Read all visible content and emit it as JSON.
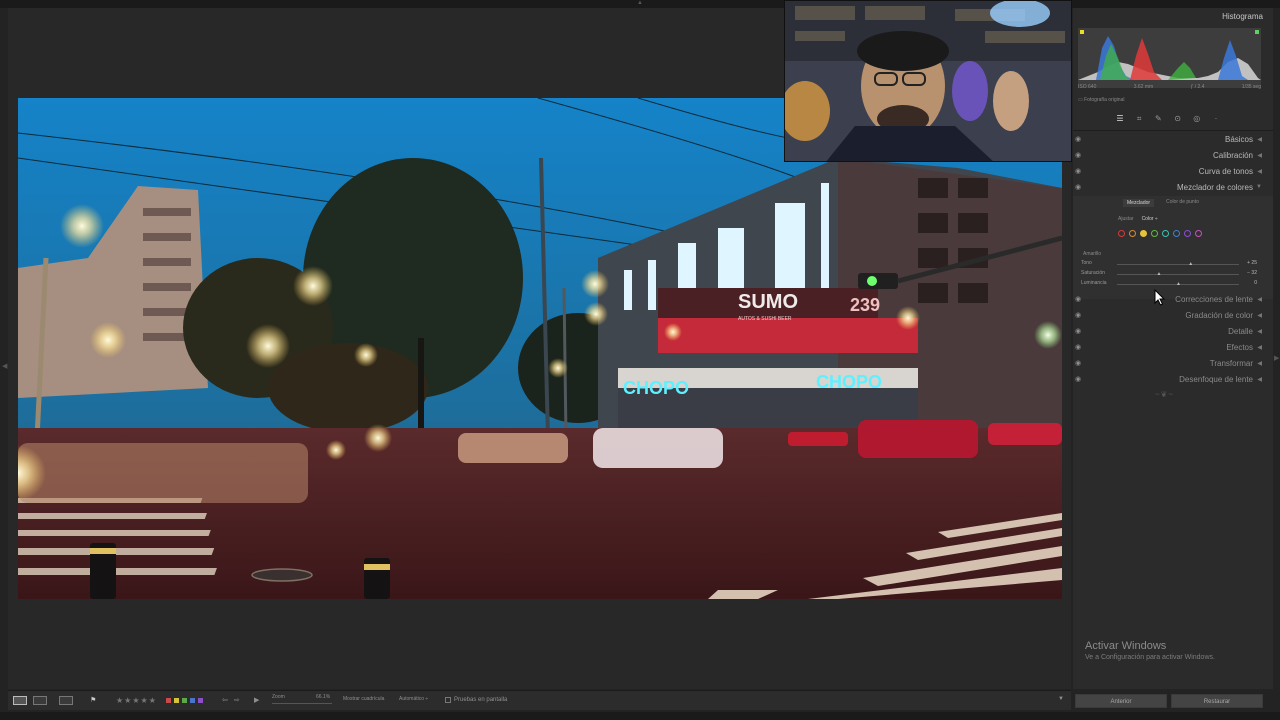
{
  "histogram": {
    "title": "Histograma",
    "meta": [
      "ISO 640",
      "3.62 mm",
      "ƒ / 2.4",
      "1/35 seg"
    ],
    "original_photo_label": "Fotografía original"
  },
  "tools": [
    "sliders-icon",
    "crop-icon",
    "heal-icon",
    "redeye-icon",
    "mask-icon",
    "brush-icon",
    "more-icon"
  ],
  "panels": {
    "basicos": "Básicos",
    "calibracion": "Calibración",
    "curva": "Curva de tonos",
    "mezclador": "Mezclador de colores",
    "correcciones": "Correcciones de lente",
    "gradacion": "Gradación de color",
    "detalle": "Detalle",
    "efectos": "Efectos",
    "transformar": "Transformar",
    "desenfoque": "Desenfoque de lente"
  },
  "mixer": {
    "tab_mixer": "Mezclador",
    "tab_point": "Color de punto",
    "adjust_label": "Ajustar",
    "adjust_value": "Color ÷",
    "selected_color": "Amarillo",
    "colors": [
      "#d23c3c",
      "#e08a2a",
      "#e6c43a",
      "#5fbf3b",
      "#3ec1b4",
      "#3b82d6",
      "#8a4fd0",
      "#d14bc3"
    ],
    "sliders": [
      {
        "name": "Tono",
        "value": "+ 25",
        "pos": 0.6
      },
      {
        "name": "Saturación",
        "value": "− 32",
        "pos": 0.34
      },
      {
        "name": "Luminancia",
        "value": "0",
        "pos": 0.5
      }
    ]
  },
  "windows": {
    "title": "Activar Windows",
    "subtitle": "Ve a Configuración para activar Windows."
  },
  "buttons": {
    "previous": "Anterior",
    "reset": "Restaurar"
  },
  "bottombar": {
    "zoom_label": "Zoom",
    "zoom_value": "66.1%",
    "grid_label": "Mostrar cuadrícula",
    "grid_value": "Automático ÷",
    "softproof_label": "Pruebas en pantalla",
    "stars": "★★★★★",
    "flags": [
      "#c94a4a",
      "#d4c43a",
      "#5fa84a",
      "#4a74c9",
      "#8a4fc9"
    ]
  },
  "photo": {
    "sign_sumo": "SUMO",
    "sign_sumo_sub": "AUTOS & SUSHI BEER",
    "sign_chopo": "CHOPO",
    "sign_chopo2": "CHOPO",
    "sign_number": "239"
  },
  "colors": {
    "sky": "#1b7bb8",
    "accent_neon": "#3fd8e8",
    "street": "#4a1e22"
  }
}
